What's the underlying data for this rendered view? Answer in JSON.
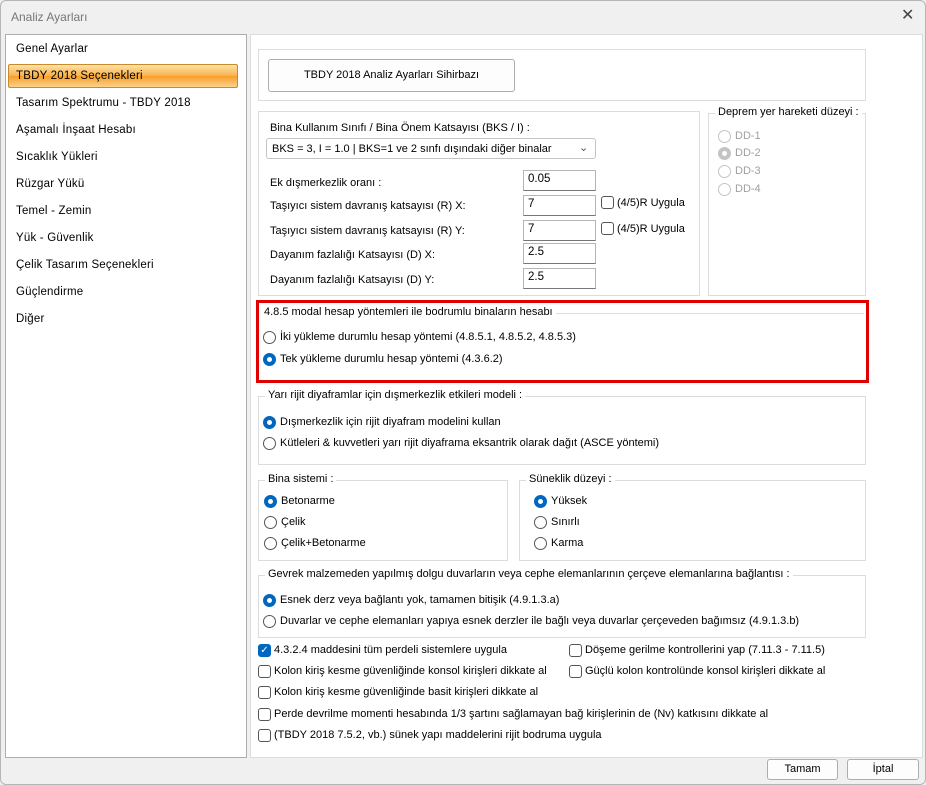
{
  "window": {
    "title": "Analiz Ayarları"
  },
  "sidebar": {
    "items": [
      {
        "label": "Genel Ayarlar"
      },
      {
        "label": "TBDY 2018 Seçenekleri",
        "selected": true
      },
      {
        "label": "Tasarım Spektrumu - TBDY 2018"
      },
      {
        "label": "Aşamalı İnşaat Hesabı"
      },
      {
        "label": "Sıcaklık Yükleri"
      },
      {
        "label": "Rüzgar Yükü"
      },
      {
        "label": "Temel - Zemin"
      },
      {
        "label": "Yük - Güvenlik"
      },
      {
        "label": "Çelik Tasarım Seçenekleri"
      },
      {
        "label": "Güçlendirme"
      },
      {
        "label": "Diğer"
      }
    ]
  },
  "wizard_button": "TBDY 2018 Analiz Ayarları Sihirbazı",
  "bks": {
    "label": "Bina Kullanım Sınıfı / Bina Önem Katsayısı (BKS / I) :",
    "value": "BKS = 3, I = 1.0 | BKS=1 ve 2 sınfı dışındaki diğer binalar"
  },
  "fields": [
    {
      "label": "Ek dışmerkezlik oranı :",
      "value": "0.05"
    },
    {
      "label": "Taşıyıcı sistem davranış katsayısı (R) X:",
      "value": "7",
      "checkbox": "(4/5)R Uygula",
      "checked": false
    },
    {
      "label": "Taşıyıcı sistem davranış katsayısı (R) Y:",
      "value": "7",
      "checkbox": "(4/5)R Uygula",
      "checked": false
    },
    {
      "label": "Dayanım fazlalığı Katsayısı (D) X:",
      "value": "2.5"
    },
    {
      "label": "Dayanım fazlalığı Katsayısı (D) Y:",
      "value": "2.5"
    }
  ],
  "deprem": {
    "label": "Deprem yer hareketi düzeyi :",
    "options": [
      "DD-1",
      "DD-2",
      "DD-3",
      "DD-4"
    ],
    "selected": "DD-2",
    "disabled": true
  },
  "modal": {
    "label": "4.8.5 modal hesap yöntemleri ile bodrumlu binaların hesabı",
    "options": [
      "İki yükleme durumlu hesap yöntemi (4.8.5.1, 4.8.5.2, 4.8.5.3)",
      "Tek yükleme durumlu hesap yöntemi (4.3.6.2)"
    ],
    "selected": 1,
    "highlight_color": "#e00000"
  },
  "diyafram": {
    "label": "Yarı rijit diyaframlar için dışmerkezlik etkileri modeli :",
    "options": [
      "Dışmerkezlik için rijit diyafram modelini kullan",
      "Kütleleri & kuvvetleri yarı rijit diyaframa eksantrik olarak dağıt (ASCE yöntemi)"
    ],
    "selected": 0
  },
  "bina": {
    "label": "Bina sistemi :",
    "options": [
      "Betonarme",
      "Çelik",
      "Çelik+Betonarme"
    ],
    "selected": 0
  },
  "suneklik": {
    "label": "Süneklik düzeyi :",
    "options": [
      "Yüksek",
      "Sınırlı",
      "Karma"
    ],
    "selected": 0
  },
  "gevrek": {
    "label": "Gevrek malzemeden yapılmış dolgu duvarların veya cephe elemanlarının çerçeve elemanlarına bağlantısı :",
    "options": [
      "Esnek derz veya bağlantı yok, tamamen bitişik (4.9.1.3.a)",
      "Duvarlar ve cephe elemanları yapıya esnek derzler ile bağlı veya duvarlar çerçeveden bağımsız (4.9.1.3.b)"
    ],
    "selected": 0
  },
  "checks": [
    {
      "label": "4.3.2.4 maddesini tüm perdeli sistemlere uygula",
      "checked": true
    },
    {
      "label": "Döşeme gerilme kontrollerini yap (7.11.3 - 7.11.5)",
      "checked": false
    },
    {
      "label": "Kolon kiriş kesme güvenliğinde konsol kirişleri dikkate al",
      "checked": false
    },
    {
      "label": "Güçlü kolon kontrolünde konsol kirişleri dikkate al",
      "checked": false
    },
    {
      "label": "Kolon kiriş kesme güvenliğinde basit kirişleri dikkate al",
      "checked": false
    },
    {
      "label": "Perde devrilme momenti hesabında 1/3 şartını sağlamayan bağ kirişlerinin de (Nv) katkısını dikkate al",
      "checked": false
    },
    {
      "label": "(TBDY 2018 7.5.2, vb.) sünek yapı maddelerini rijit bodruma uygula",
      "checked": false
    }
  ],
  "buttons": {
    "ok": "Tamam",
    "cancel": "İptal"
  }
}
